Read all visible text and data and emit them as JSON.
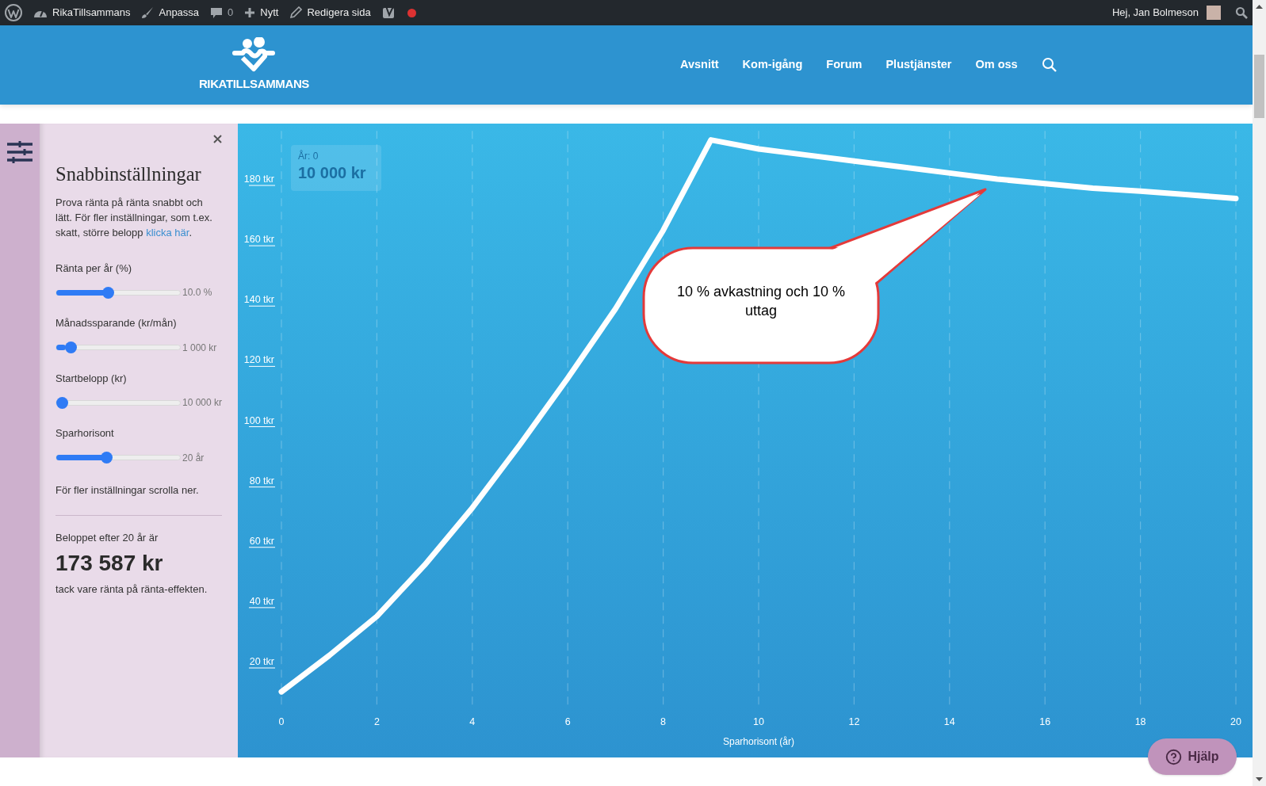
{
  "admin_bar": {
    "site": "RikaTillsammans",
    "customize": "Anpassa",
    "comments": "0",
    "new": "Nytt",
    "edit": "Redigera sida",
    "greeting": "Hej, Jan Bolmeson"
  },
  "header": {
    "logo_text": "RIKATILLSAMMANS",
    "nav": [
      "Avsnitt",
      "Kom-igång",
      "Forum",
      "Plustjänster",
      "Om oss"
    ]
  },
  "panel": {
    "title": "Snabbinställningar",
    "intro": "Prova ränta på ränta snabbt och lätt. För fler inställningar, som t.ex. skatt, större belopp",
    "intro_link": "klicka här",
    "intro_end": ".",
    "sliders": [
      {
        "label": "Ränta per år (%)",
        "level": 0.41,
        "reading": "10.0 %"
      },
      {
        "label": "Månadssparande (kr/mån)",
        "level": 0.08,
        "reading": "1 000 kr"
      },
      {
        "label": "Startbelopp (kr)",
        "level": 0.0,
        "reading": "10 000 kr"
      },
      {
        "label": "Sparhorisont",
        "level": 0.4,
        "reading": "20 år"
      }
    ],
    "scroll_hint": "För fler inställningar scrolla ner.",
    "result_label": "Beloppet efter 20 år är",
    "result_value": "173 587 kr",
    "result_note": "tack vare ränta på ränta-effekten."
  },
  "chart": {
    "tooltip": {
      "label": "År: 0",
      "value": "10 000 kr"
    },
    "chart_data": {
      "type": "line",
      "xlabel": "Sparhorisont (år)",
      "x": [
        0,
        1,
        2,
        3,
        4,
        5,
        6,
        7,
        8,
        9,
        10,
        11,
        12,
        13,
        14,
        15,
        16,
        17,
        18,
        19,
        20
      ],
      "grid": true,
      "series": [
        {
          "color": "#ffffff",
          "values": [
            10,
            22,
            35,
            52,
            71,
            92,
            114,
            137,
            163,
            193,
            190,
            188,
            186,
            184,
            182,
            180,
            178.5,
            177,
            176,
            174.8,
            173.6
          ]
        }
      ],
      "xlim": [
        0,
        20
      ],
      "ylim": [
        5,
        196
      ],
      "xticks": [
        0,
        2,
        4,
        6,
        8,
        10,
        12,
        14,
        16,
        18,
        20
      ],
      "yticks": [
        {
          "value": 20,
          "label": "20 tkr"
        },
        {
          "value": 40,
          "label": "40 tkr"
        },
        {
          "value": 60,
          "label": "60 tkr"
        },
        {
          "value": 80,
          "label": "80 tkr"
        },
        {
          "value": 100,
          "label": "100 tkr"
        },
        {
          "value": 120,
          "label": "120 tkr"
        },
        {
          "value": 140,
          "label": "140 tkr"
        },
        {
          "value": 160,
          "label": "160 tkr"
        },
        {
          "value": 180,
          "label": "180 tkr"
        }
      ],
      "annotations": [
        "10 % avkastning och 10 % uttag"
      ]
    }
  },
  "help_button": "Hjälp"
}
